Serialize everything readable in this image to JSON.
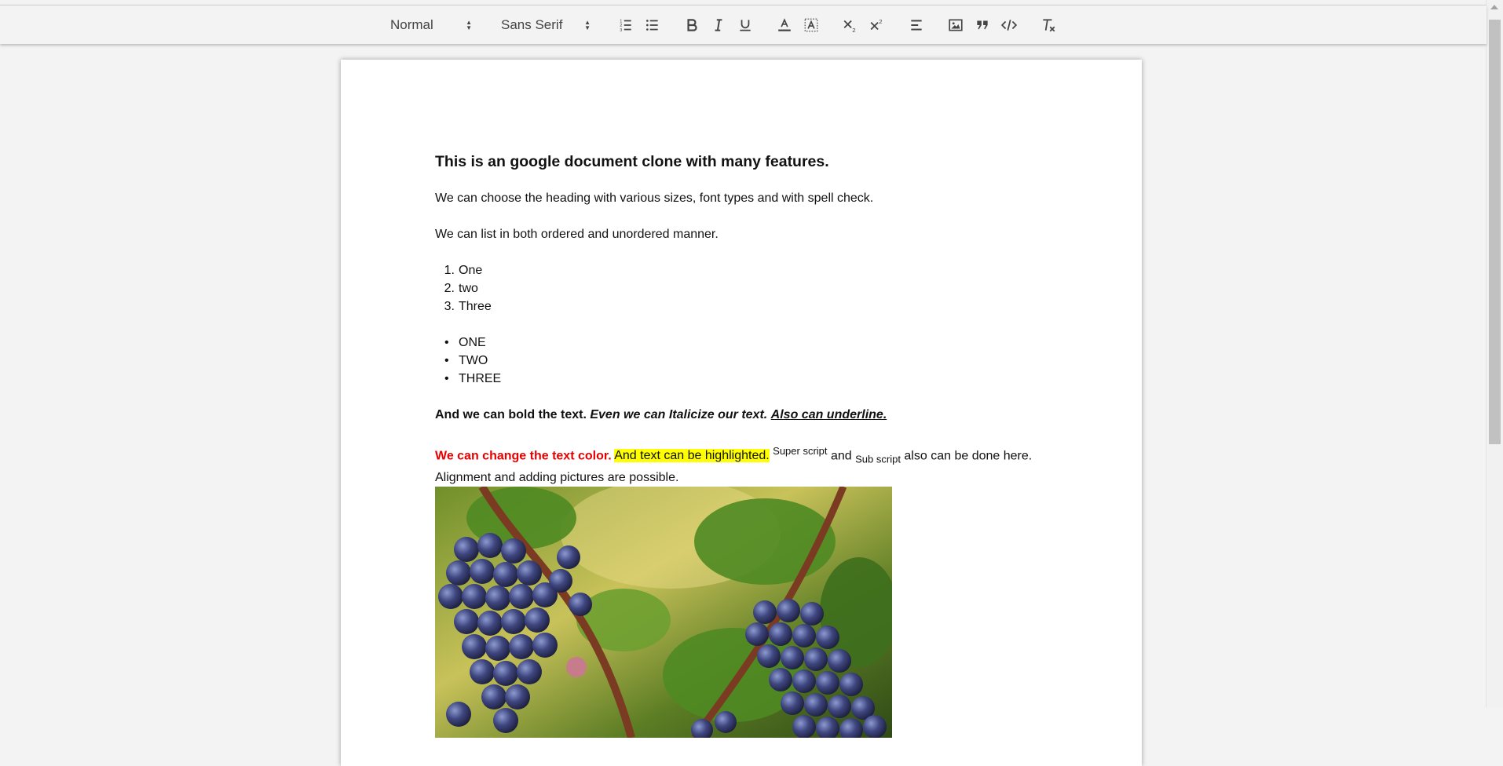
{
  "toolbar": {
    "header_select": "Normal",
    "font_select": "Sans Serif",
    "buttons": {
      "ordered_list": "ordered-list-icon",
      "bullet_list": "bullet-list-icon",
      "bold": "bold-icon",
      "italic": "italic-icon",
      "underline": "underline-icon",
      "text_color": "text-color-icon",
      "highlight": "background-color-icon",
      "subscript": "subscript-icon",
      "superscript": "superscript-icon",
      "align": "align-icon",
      "image": "image-icon",
      "blockquote": "blockquote-icon",
      "code": "code-block-icon",
      "clear_format": "clear-format-icon"
    }
  },
  "document": {
    "heading": "This is an google document clone with many features.",
    "para1": "We can choose the heading with various sizes, font types and with spell check.",
    "para2": "We can list in both ordered and unordered manner.",
    "ordered_list": [
      {
        "num": "1.",
        "text": "One"
      },
      {
        "num": "2.",
        "text": "two"
      },
      {
        "num": "3.",
        "text": "Three"
      }
    ],
    "bullet_list": [
      {
        "bullet": "•",
        "text": "ONE"
      },
      {
        "bullet": "•",
        "text": "TWO"
      },
      {
        "bullet": "•",
        "text": "THREE"
      }
    ],
    "bold_text": "And we can bold the text.",
    "italic_text": "Even we can Italicize our text.",
    "underline_text": "Also can underline.",
    "color_text": "We can change the text color.",
    "highlight_text": "And text can be highlighted.",
    "superscript_text": "Super script",
    "and_text": "and",
    "subscript_text": "Sub script",
    "tail_text": "also can be done here. Alignment and adding pictures are possible.",
    "image_subject": "grapes-on-vine-photo"
  },
  "colors": {
    "text_color": "#e60000",
    "highlight_color": "#ffff00",
    "background": "#f3f3f3"
  }
}
